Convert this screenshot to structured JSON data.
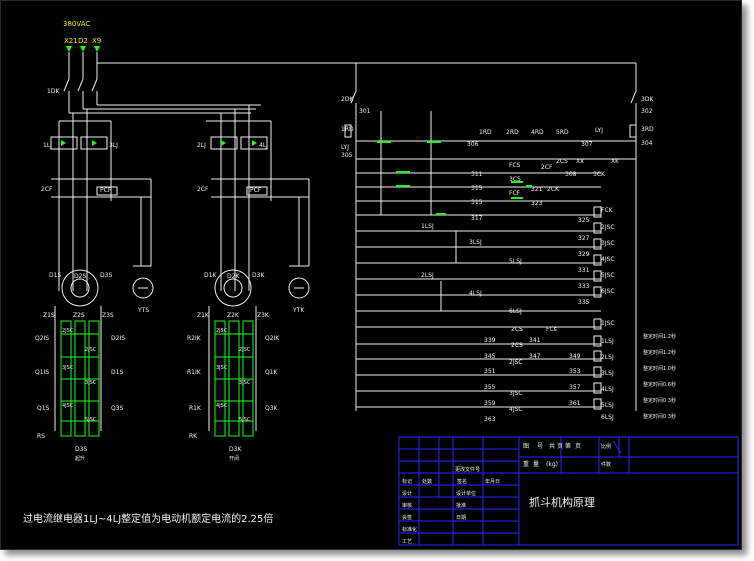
{
  "supply": {
    "voltage": "380VAC",
    "phases": [
      "X21",
      "D2",
      "X9"
    ]
  },
  "left_panel": {
    "breaker": "1DK",
    "relays": [
      "1LJ",
      "3LJ"
    ],
    "contactor": "2CF",
    "contactor2": "PCF",
    "motor": "D2S",
    "motor_terms": [
      "D1S",
      "D3S"
    ],
    "brake": "YTS",
    "term_row": [
      "Z1S",
      "Z2S",
      "Z3S"
    ],
    "res_labels": [
      "Q2IS",
      "Q1IS",
      "Q1S",
      "RS"
    ],
    "res_right": [
      "D2IS",
      "D1S",
      "Q3S"
    ],
    "step_labels": [
      "2JSC",
      "3JSC",
      "4JSC",
      "5JSC"
    ],
    "step_right": [
      "2JSC",
      "3JSC",
      "4JSC",
      "5JSC"
    ],
    "bottom_label": "D3S",
    "bottom_sub": "起升"
  },
  "mid_panel": {
    "relays": [
      "2LJ",
      "4LJ"
    ],
    "contactor": "2CF",
    "contactor2": "PCF",
    "motor": "D2K",
    "motor_terms": [
      "D1K",
      "D3K"
    ],
    "brake": "YTK",
    "term_row": [
      "Z1K",
      "Z2K",
      "Z3K"
    ],
    "res_labels": [
      "R2IK",
      "R1IK",
      "R1K",
      "RK"
    ],
    "res_right": [
      "Q2IK",
      "Q1K",
      "Q3K"
    ],
    "step_labels": [
      "2JSC",
      "3JSC",
      "4JSC",
      "5JSC"
    ],
    "step_right": [
      "2JSC",
      "3JSC",
      "4JSC",
      "5JSC"
    ],
    "bottom_label": "D3K",
    "bottom_sub": "开闭"
  },
  "control": {
    "breakers": [
      "2DK",
      "3DK"
    ],
    "nodes_left": [
      "301",
      "1RD",
      "LYJ",
      "305"
    ],
    "nodes_right": [
      "302",
      "3RD",
      "304"
    ],
    "fuses": [
      "1RD",
      "2RD",
      "4RD",
      "5RD",
      "6RD"
    ],
    "top_wire": [
      "306",
      "307",
      "LYJ"
    ],
    "mid_labels": [
      "FCS",
      "2CS",
      "Xx",
      "Xk",
      "2CF",
      "3CK",
      "308",
      "2CK",
      "3CS",
      "FCF",
      "321",
      "323",
      "FCK"
    ],
    "row_labels": [
      "311",
      "315",
      "315",
      "317"
    ],
    "relay_labels": [
      "1LSJ",
      "3LSJ",
      "5LSJ",
      "2LSJ",
      "4LSJ",
      "6LSJ"
    ],
    "coil_labels": [
      "FCK",
      "2JSC",
      "3JSC",
      "4JSC",
      "5JSC",
      "6JSC"
    ],
    "coil_numbers": [
      "325",
      "327",
      "329",
      "331",
      "333",
      "335"
    ],
    "lower_labels": [
      "2CS",
      "FCs",
      "2CS",
      "2JSC",
      "3JSC",
      "4JSC"
    ],
    "lower_left_nums": [
      "339",
      "345",
      "351",
      "355",
      "359",
      "363"
    ],
    "lower_mid_nums": [
      "341",
      "347",
      "353",
      "357",
      "361"
    ],
    "lower_coils": [
      "1LSJ",
      "2LSJ",
      "3LSJ",
      "4LSJ",
      "5LSJ",
      "6LSJ"
    ],
    "lower_third": [
      "349",
      "1JSC"
    ],
    "delays": [
      "整定时间1.2秒",
      "整定时间1.2秒",
      "整定时间1.0秒",
      "整定时间0.6秒",
      "整定时间0.3秒",
      "整定时间0.3秒"
    ]
  },
  "note": "过电流继电器1LJ~4LJ整定值为电动机额定电流的2.25倍",
  "title_block": {
    "title": "抓斗机构原理",
    "header_cells": [
      "图",
      "号",
      "共",
      "页",
      "第",
      "页",
      "比例",
      "件数",
      "重",
      "量",
      "(kg)"
    ],
    "left_rows": [
      "设计",
      "审核",
      "会签",
      "标准化",
      "工艺"
    ],
    "left_sub": [
      "年月日",
      "签名",
      "更改文件号",
      "标记",
      "处数"
    ],
    "left_names": [
      "设计单位",
      "批准",
      "日期"
    ]
  }
}
